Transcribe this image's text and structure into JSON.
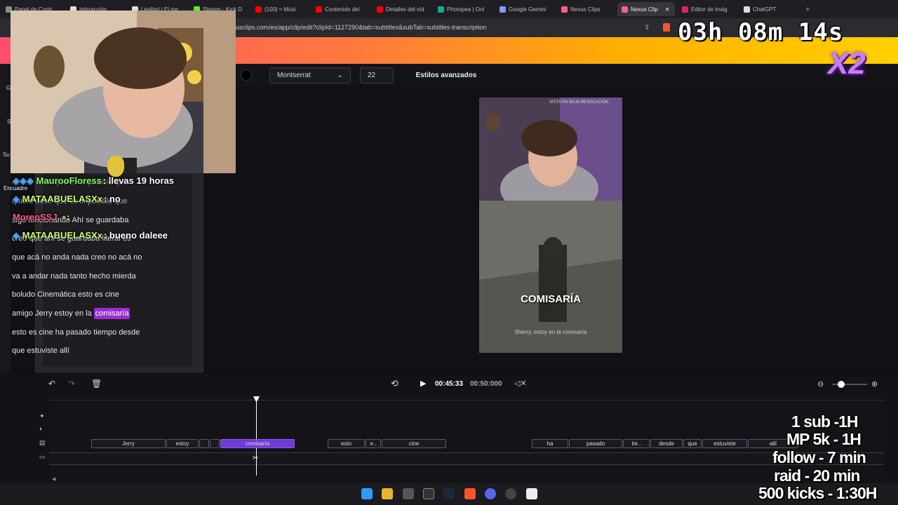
{
  "browser": {
    "tabs": [
      {
        "label": "Panel de Contr",
        "color": "#8c8c8c"
      },
      {
        "label": "Interacción",
        "color": "#dddddd"
      },
      {
        "label": "Lealtad | El me",
        "color": "#dddddd"
      },
      {
        "label": "Stream - Kick D",
        "color": "#53fc18"
      },
      {
        "label": "(100) ≈ Músi",
        "color": "#ff0000"
      },
      {
        "label": "Contenido del",
        "color": "#ff0000"
      },
      {
        "label": "Detalles del víd",
        "color": "#ff0000"
      },
      {
        "label": "Photopea | Onl",
        "color": "#18a497"
      },
      {
        "label": "Google Gemini",
        "color": "#7b9cff"
      },
      {
        "label": "Nexus Clips",
        "color": "#ff5f8a"
      },
      {
        "label": "Nexus Clip",
        "color": "#ff5f8a"
      },
      {
        "label": "Editor de imág",
        "color": "#e0245e"
      },
      {
        "label": "ChatGPT",
        "color": "#dddddd"
      }
    ],
    "url": "usclips.com/es/app/clip/edit?clipId=1127290&tab=subtitles&subTab=subtitles-transcription"
  },
  "toolbar": {
    "font": "Montserrat",
    "size": "22",
    "advanced_label": "Estilos avanzados"
  },
  "sidebar_labels": {
    "g": "G",
    "s": "S",
    "su": "Su",
    "encuadre": "Encuadre"
  },
  "chat": [
    {
      "user": "MaurooFloress",
      "msg": ": llevas 19 horas",
      "color": "#7dff5a"
    },
    {
      "user": "MATAABUELASXx",
      "msg": ": no",
      "color": "#c8ff7a"
    },
    {
      "user": "MorepSSJ",
      "msg": ":",
      "color": "#ff5a8a"
    },
    {
      "user": "MATAABUELASXx",
      "msg": ": bueno daleee",
      "color": "#c8ff7a"
    }
  ],
  "transcript": {
    "line1": "quiero decir que es imposible que",
    "line2": "sigo funcionando Ahí se guardaba",
    "line3": "creo que ahí se guardaba literal es",
    "line4": "que acá no anda nada creo no acá no",
    "line5": "va  a  andar nada tanto hecho mierda",
    "line6": "boludo Cinemática esto es cine",
    "line7a": "amigo Jerry estoy en la ",
    "line7b": "comisaría",
    "line8": "esto es cine ha pasado tiempo desde",
    "line9": "que estuviste allí"
  },
  "preview": {
    "watermark": "VISTA EN BAJA RESOLUCIÓN",
    "caption": "COMISARÍA",
    "subtitle": "Sherry, estoy en la comisaría"
  },
  "player": {
    "current": "00:45:33",
    "total": "00:50:000"
  },
  "words": [
    {
      "label": "Jerry"
    },
    {
      "label": "estoy"
    },
    {
      "label": ""
    },
    {
      "label": ""
    },
    {
      "label": "comisaría"
    },
    {
      "label": "esto"
    },
    {
      "label": "e.."
    },
    {
      "label": "cine"
    },
    {
      "label": "ha"
    },
    {
      "label": "pasado"
    },
    {
      "label": "tie.."
    },
    {
      "label": "desde"
    },
    {
      "label": "que"
    },
    {
      "label": "estuviste"
    },
    {
      "label": "allí"
    }
  ],
  "overlay": {
    "timer": "03h 08m 14s",
    "badge": "X2",
    "goal1": "1 sub -1H",
    "goal2": "MP 5k - 1H",
    "goal3": "follow - 7 min",
    "goal4": "raid - 20 min",
    "goal5": "500 kicks - 1:30H"
  }
}
